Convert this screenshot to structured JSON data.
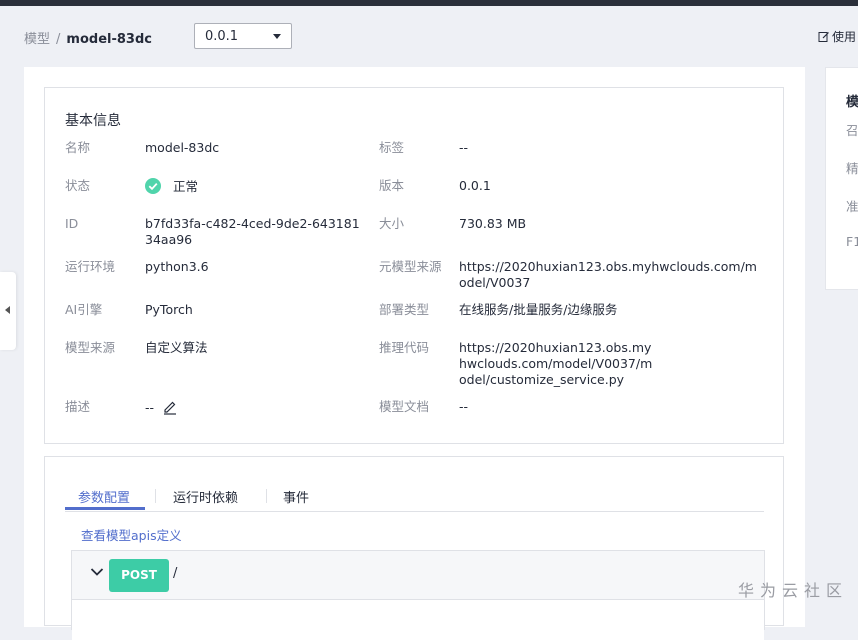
{
  "breadcrumb": {
    "root": "模型",
    "separator": "/",
    "current": "model-83dc"
  },
  "version_select": {
    "value": "0.0.1"
  },
  "header": {
    "use_label": "使用"
  },
  "basic_info": {
    "title": "基本信息",
    "left": [
      {
        "label": "名称",
        "value": "model-83dc"
      },
      {
        "label": "状态",
        "value": "正常"
      },
      {
        "label": "ID",
        "value": "b7fd33fa-c482-4ced-9de2-64318134aa96"
      },
      {
        "label": "运行环境",
        "value": "python3.6"
      },
      {
        "label": "AI引擎",
        "value": "PyTorch"
      },
      {
        "label": "模型来源",
        "value": "自定义算法"
      },
      {
        "label": "描述",
        "value": "--"
      }
    ],
    "right": [
      {
        "label": "标签",
        "value": "--"
      },
      {
        "label": "版本",
        "value": "0.0.1"
      },
      {
        "label": "大小",
        "value": "730.83 MB"
      },
      {
        "label": "元模型来源",
        "value": "https://2020huxian123.obs.myhwclouds.com/model/V0037"
      },
      {
        "label": "部署类型",
        "value": "在线服务/批量服务/边缘服务"
      },
      {
        "label": "推理代码",
        "value": "https://2020huxian123.obs.myhwclouds.com/model/V0037/model/customize_service.py"
      },
      {
        "label": "模型文档",
        "value": "--"
      }
    ]
  },
  "tabs": [
    {
      "label": "参数配置",
      "active": true
    },
    {
      "label": "运行时依赖",
      "active": false
    },
    {
      "label": "事件",
      "active": false
    }
  ],
  "api": {
    "link_label": "查看模型apis定义",
    "method": "POST",
    "path": "/"
  },
  "right_panel": {
    "title": "模",
    "items": [
      "召",
      "精",
      "准",
      "F1"
    ]
  },
  "watermark": "华为云社区",
  "colors": {
    "accent": "#526ecc",
    "success": "#3dcca6",
    "status_ok": "#50d4ab"
  }
}
